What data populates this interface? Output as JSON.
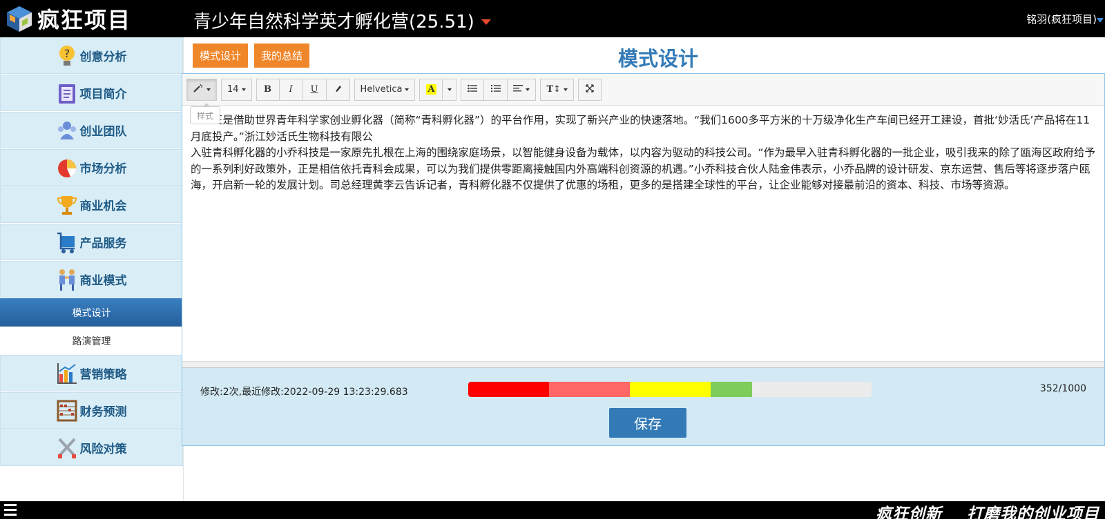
{
  "header": {
    "logo_text": "疯狂项目",
    "project_title": "青少年自然科学英才孵化营(25.51)",
    "user": "铭羽(疯狂项目)"
  },
  "sidebar": {
    "items": [
      {
        "label": "创意分析",
        "icon": "lightbulb-question-icon"
      },
      {
        "label": "项目简介",
        "icon": "clipboard-icon"
      },
      {
        "label": "创业团队",
        "icon": "team-icon"
      },
      {
        "label": "市场分析",
        "icon": "pie-chart-icon"
      },
      {
        "label": "商业机会",
        "icon": "trophy-icon"
      },
      {
        "label": "产品服务",
        "icon": "cart-icon"
      },
      {
        "label": "商业模式",
        "icon": "handshake-icon"
      }
    ],
    "sub_items": [
      "模式设计",
      "路演管理"
    ],
    "items_after": [
      {
        "label": "营销策略",
        "icon": "bar-chart-icon"
      },
      {
        "label": "财务预测",
        "icon": "abacus-icon"
      },
      {
        "label": "风险对策",
        "icon": "crossed-swords-icon"
      }
    ]
  },
  "main": {
    "tabs": [
      "模式设计",
      "我的总结"
    ],
    "page_title": "模式设计",
    "toolbar": {
      "font_size": "14",
      "font_family": "Helvetica",
      "tooltip": "样式",
      "buttons": [
        "magic-wand",
        "bold",
        "italic",
        "underline",
        "eraser",
        "text-color",
        "unordered-list",
        "ordered-list",
        "align",
        "line-height",
        "fullscreen"
      ]
    },
    "content": {
      "p1": "正是借助世界青年科学家创业孵化器（简称“青科孵化器”）的平台作用，实现了新兴产业的快速落地。“我们1600多平方米的十万级净化生产车间已经开工建设，首批‘妙活氏’产品将在11月底投产。”浙江妙活氏生物科技有限公",
      "p2": "入驻青科孵化器的小乔科技是一家原先扎根在上海的围绕家庭场景，以智能健身设备为载体，以内容为驱动的科技公司。“作为最早入驻青科孵化器的一批企业，吸引我来的除了瓯海区政府给予的一系列利好政策外，正是相信依托青科会成果，可以为我们提供零距离接触国内外高端科创资源的机遇。”小乔科技合伙人陆金伟表示，小乔品牌的设计研发、京东运营、售后等将逐步落户瓯海，开启新一轮的发展计划。司总经理黄李云告诉记者，青科孵化器不仅提供了优惠的场租，更多的是搭建全球性的平台，让企业能够对接最前沿的资本、科技、市场等资源。"
    },
    "status": {
      "modified": "修改:2次,最近修改:2022-09-29 13:23:29.683",
      "counter": "352/1000",
      "progress_fraction": 0.352,
      "progress_colors": [
        "#ff0000",
        "#ff6666",
        "#ffff00",
        "#7dcc5c"
      ]
    },
    "save_label": "保存"
  },
  "footer": {
    "slogan": "疯狂创新    打磨我的创业项目"
  },
  "colors": {
    "tab": "#f0862a",
    "accent": "#337ab7",
    "sidebar_bg": "#d9edf7",
    "sidebar_text": "#1f5b86"
  }
}
